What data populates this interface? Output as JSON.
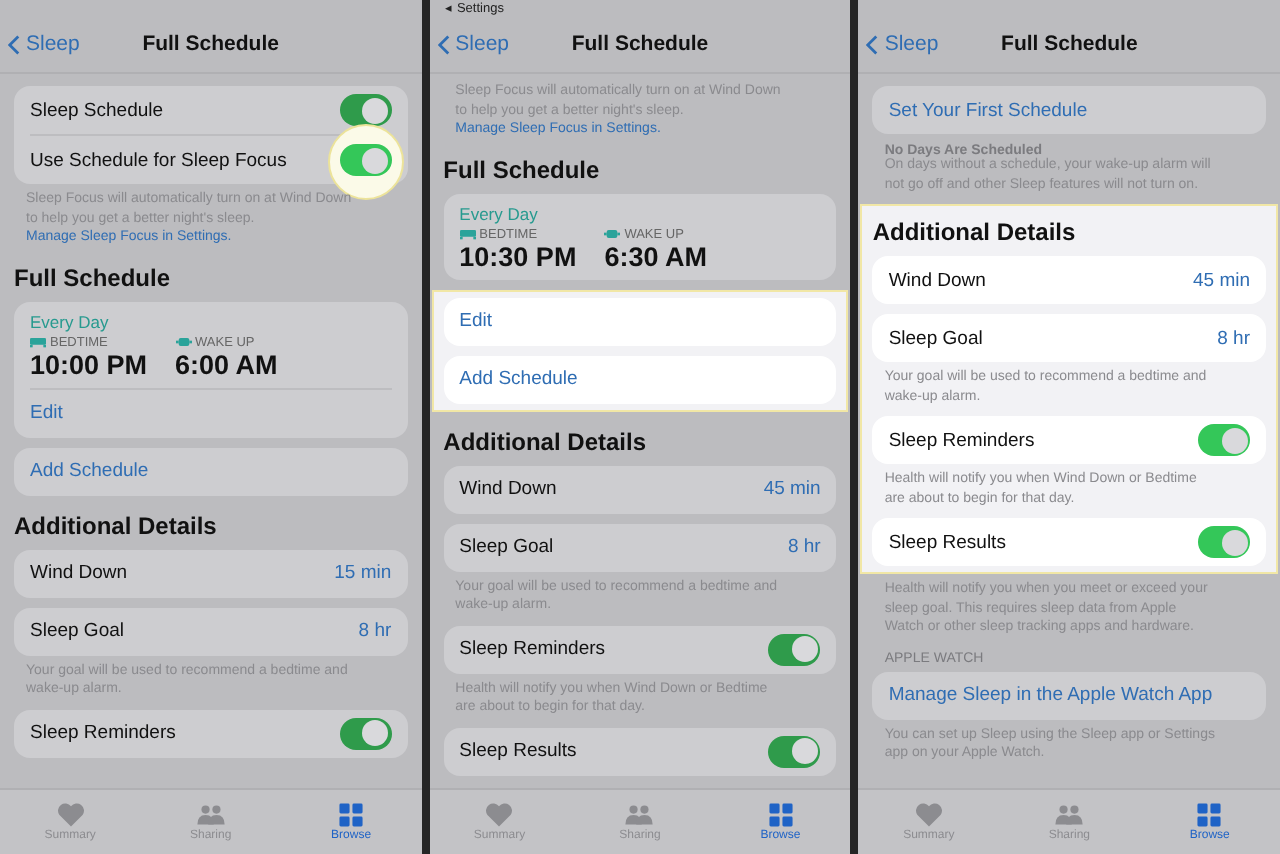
{
  "panels": [
    {
      "nav": {
        "back": "Sleep",
        "title": "Full Schedule"
      },
      "blocks": [
        {
          "kind": "card",
          "rows": [
            {
              "kind": "toggle",
              "label": "Sleep Schedule",
              "on": true,
              "spotlight": false
            },
            {
              "kind": "toggle",
              "label": "Use Schedule for Sleep Focus",
              "on": true,
              "spotlight": true
            }
          ]
        },
        {
          "kind": "footnote",
          "text": "Sleep Focus will automatically turn on at Wind Down to help you get a better night's sleep.",
          "link": "Manage Sleep Focus in Settings."
        },
        {
          "kind": "header",
          "text": "Full Schedule"
        },
        {
          "kind": "card",
          "rows": [
            {
              "kind": "schedule",
              "days": "Every Day",
              "bed_label": "BEDTIME",
              "bed_time": "10:00 PM",
              "wake_label": "WAKE UP",
              "wake_time": "6:00 AM"
            },
            {
              "kind": "link",
              "label": "Edit"
            }
          ]
        },
        {
          "kind": "card",
          "rows": [
            {
              "kind": "link",
              "label": "Add Schedule"
            }
          ]
        },
        {
          "kind": "header",
          "text": "Additional Details"
        },
        {
          "kind": "card",
          "rows": [
            {
              "kind": "value",
              "label": "Wind Down",
              "value": "15 min"
            }
          ]
        },
        {
          "kind": "card",
          "rows": [
            {
              "kind": "value",
              "label": "Sleep Goal",
              "value": "8 hr"
            }
          ]
        },
        {
          "kind": "footnote",
          "text": "Your goal will be used to recommend a bedtime and wake-up alarm."
        },
        {
          "kind": "card",
          "rows": [
            {
              "kind": "toggle",
              "label": "Sleep Reminders",
              "on": true,
              "spotlight": false
            }
          ]
        }
      ],
      "tabs": [
        {
          "label": "Summary",
          "selected": false
        },
        {
          "label": "Sharing",
          "selected": false
        },
        {
          "label": "Browse",
          "selected": true
        }
      ]
    },
    {
      "status_back": "◂ Settings",
      "nav": {
        "back": "Sleep",
        "title": "Full Schedule"
      },
      "blocks": [
        {
          "kind": "footnote",
          "text": "Sleep Focus will automatically turn on at Wind Down to help you get a better night's sleep.",
          "link": "Manage Sleep Focus in Settings."
        },
        {
          "kind": "header",
          "text": "Full Schedule"
        },
        {
          "kind": "card",
          "rows": [
            {
              "kind": "schedule",
              "days": "Every Day",
              "bed_label": "BEDTIME",
              "bed_time": "10:30 PM",
              "wake_label": "WAKE UP",
              "wake_time": "6:30 AM"
            }
          ]
        },
        {
          "kind": "highlight",
          "blocks": [
            {
              "kind": "card",
              "rows": [
                {
                  "kind": "link",
                  "label": "Edit"
                }
              ]
            },
            {
              "kind": "card",
              "rows": [
                {
                  "kind": "link",
                  "label": "Add Schedule"
                }
              ]
            }
          ]
        },
        {
          "kind": "header",
          "text": "Additional Details"
        },
        {
          "kind": "card",
          "rows": [
            {
              "kind": "value",
              "label": "Wind Down",
              "value": "45 min"
            }
          ]
        },
        {
          "kind": "card",
          "rows": [
            {
              "kind": "value",
              "label": "Sleep Goal",
              "value": "8 hr"
            }
          ]
        },
        {
          "kind": "footnote",
          "text": "Your goal will be used to recommend a bedtime and wake-up alarm."
        },
        {
          "kind": "card",
          "rows": [
            {
              "kind": "toggle",
              "label": "Sleep Reminders",
              "on": true,
              "spotlight": false
            }
          ]
        },
        {
          "kind": "footnote",
          "text": "Health will notify you when Wind Down or Bedtime are about to begin for that day."
        },
        {
          "kind": "card",
          "rows": [
            {
              "kind": "toggle",
              "label": "Sleep Results",
              "on": true,
              "spotlight": false
            }
          ]
        }
      ],
      "tabs": [
        {
          "label": "Summary",
          "selected": false
        },
        {
          "label": "Sharing",
          "selected": false
        },
        {
          "label": "Browse",
          "selected": true
        }
      ]
    },
    {
      "nav": {
        "back": "Sleep",
        "title": "Full Schedule"
      },
      "blocks": [
        {
          "kind": "card",
          "rows": [
            {
              "kind": "link",
              "label": "Set Your First Schedule"
            }
          ]
        },
        {
          "kind": "caption",
          "text": "No Days Are Scheduled"
        },
        {
          "kind": "footnote",
          "text": "On days without a schedule, your wake-up alarm will not go off and other Sleep features will not turn on."
        },
        {
          "kind": "highlight",
          "blocks": [
            {
              "kind": "header",
              "text": "Additional Details"
            },
            {
              "kind": "card",
              "rows": [
                {
                  "kind": "value",
                  "label": "Wind Down",
                  "value": "45 min"
                }
              ]
            },
            {
              "kind": "card",
              "rows": [
                {
                  "kind": "value",
                  "label": "Sleep Goal",
                  "value": "8 hr"
                }
              ]
            },
            {
              "kind": "footnote",
              "text": "Your goal will be used to recommend a bedtime and wake-up alarm."
            },
            {
              "kind": "card",
              "rows": [
                {
                  "kind": "toggle",
                  "label": "Sleep Reminders",
                  "on": true,
                  "spotlight": false
                }
              ]
            },
            {
              "kind": "footnote",
              "text": "Health will notify you when Wind Down or Bedtime are about to begin for that day."
            },
            {
              "kind": "card",
              "rows": [
                {
                  "kind": "toggle",
                  "label": "Sleep Results",
                  "on": true,
                  "spotlight": false
                }
              ]
            }
          ]
        },
        {
          "kind": "footnote",
          "text": "Health will notify you when you meet or exceed your sleep goal. This requires sleep data from Apple Watch or other sleep tracking apps and hardware."
        },
        {
          "kind": "section",
          "text": "APPLE WATCH"
        },
        {
          "kind": "card",
          "rows": [
            {
              "kind": "link",
              "label": "Manage Sleep in the Apple Watch App"
            }
          ]
        },
        {
          "kind": "footnote",
          "text": "You can set up Sleep using the Sleep app or Settings app on your Apple Watch."
        }
      ],
      "tabs": [
        {
          "label": "Summary",
          "selected": false
        },
        {
          "label": "Sharing",
          "selected": false
        },
        {
          "label": "Browse",
          "selected": true
        }
      ]
    }
  ]
}
